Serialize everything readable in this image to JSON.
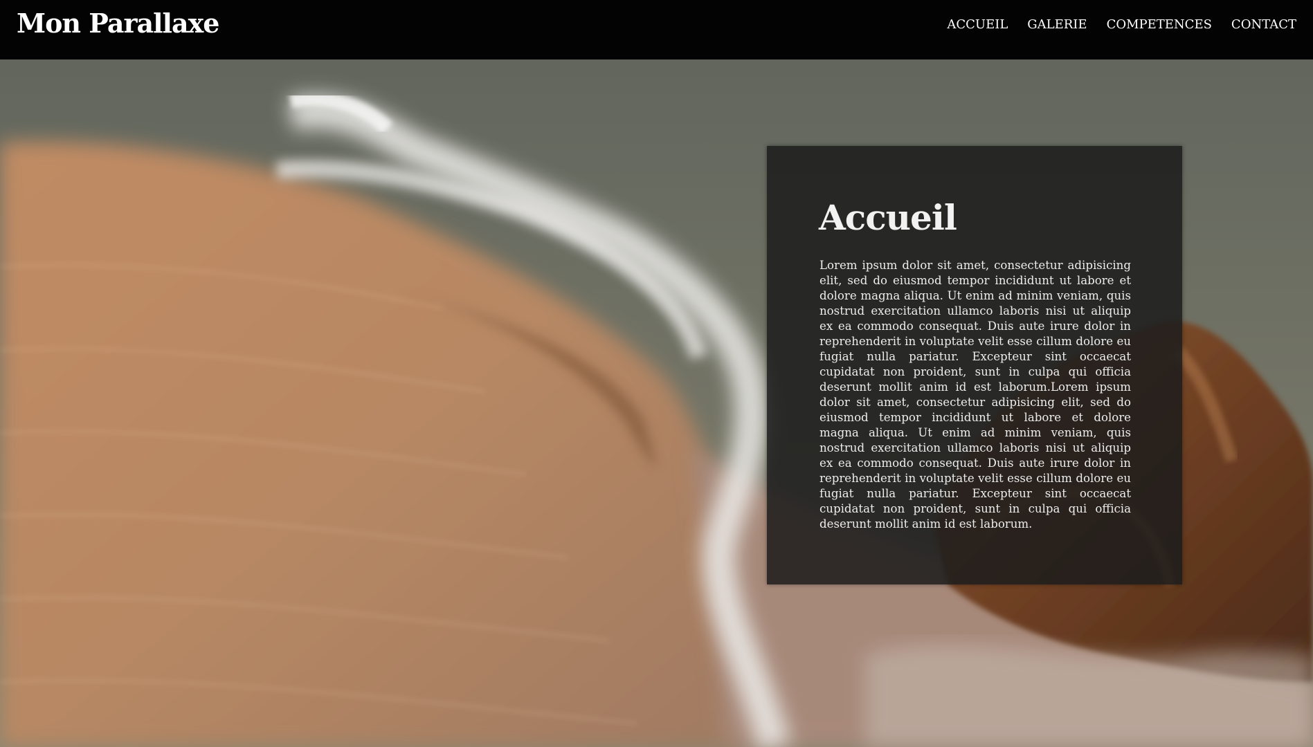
{
  "header": {
    "brand": "Mon Parallaxe",
    "nav": [
      {
        "label": "ACCUEIL"
      },
      {
        "label": "GALERIE"
      },
      {
        "label": "COMPETENCES"
      },
      {
        "label": "CONTACT"
      }
    ]
  },
  "hero": {
    "image": "beach-wave-rocks-photo",
    "panel": {
      "title": "Accueil",
      "text": "Lorem ipsum dolor sit amet, consectetur adipisicing elit, sed do eiusmod tempor incididunt ut labore et dolore magna aliqua. Ut enim ad minim veniam, quis nostrud exercitation ullamco laboris nisi ut aliquip ex ea commodo consequat. Duis aute irure dolor in reprehenderit in voluptate velit esse cillum dolore eu fugiat nulla pariatur. Excepteur sint occaecat cupidatat non proident, sunt in culpa qui officia deserunt mollit anim id est laborum.Lorem ipsum dolor sit amet, consectetur adipisicing elit, sed do eiusmod tempor incididunt ut labore et dolore magna aliqua. Ut enim ad minim veniam, quis nostrud exercitation ullamco laboris nisi ut aliquip ex ea commodo consequat. Duis aute irure dolor in reprehenderit in voluptate velit esse cillum dolore eu fugiat nulla pariatur. Excepteur sint occaecat cupidatat non proident, sunt in culpa qui officia deserunt mollit anim id est laborum."
    }
  },
  "colors": {
    "navbar_bg": "#030303",
    "nav_text": "#ffffff",
    "panel_bg": "#1c1c1c",
    "sand": "#b98a66",
    "sea": "#6f7468",
    "foam": "#e8e6e2",
    "rock": "#7a4a2c"
  }
}
